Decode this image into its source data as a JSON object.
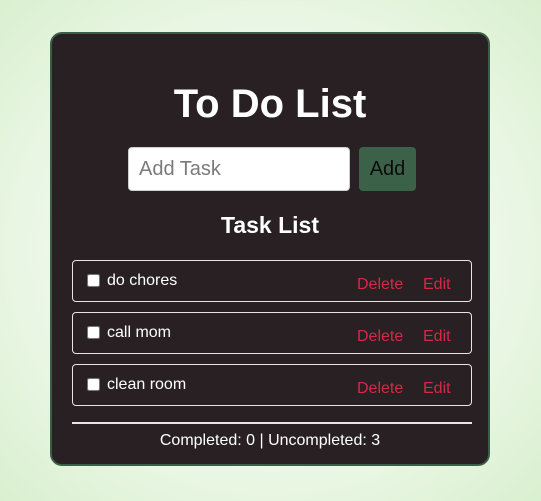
{
  "app": {
    "title": "To Do List"
  },
  "input": {
    "placeholder": "Add Task",
    "value": "",
    "add_label": "Add"
  },
  "list": {
    "heading": "Task List",
    "tasks": [
      {
        "text": "do chores",
        "checked": false,
        "delete_label": "Delete",
        "edit_label": "Edit"
      },
      {
        "text": "call mom",
        "checked": false,
        "delete_label": "Delete",
        "edit_label": "Edit"
      },
      {
        "text": "clean room",
        "checked": false,
        "delete_label": "Delete",
        "edit_label": "Edit"
      }
    ]
  },
  "summary": {
    "text": "Completed: 0 | Uncompleted: 3"
  },
  "colors": {
    "card_background": "#282022",
    "card_border": "#3b5e48",
    "add_button": "#3b6248",
    "action_link": "#d42a4a",
    "page_background": "#d9f0cf"
  }
}
